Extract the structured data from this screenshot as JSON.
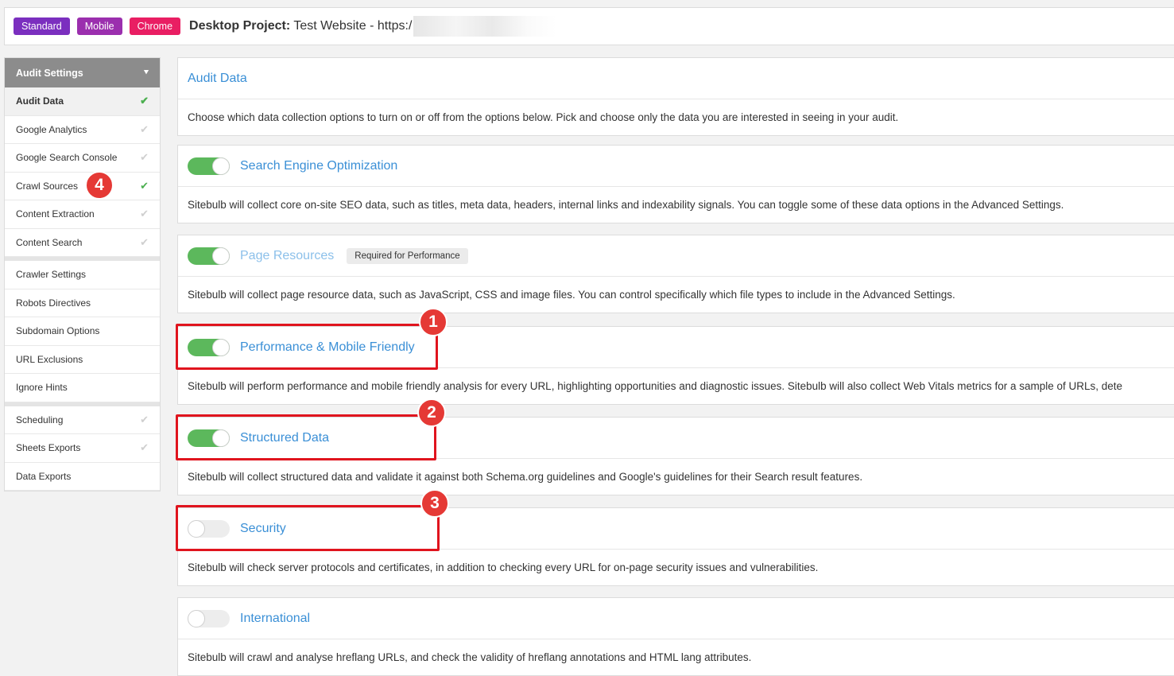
{
  "header": {
    "pills": [
      {
        "label": "Standard",
        "color": "#7b2fbf"
      },
      {
        "label": "Mobile",
        "color": "#9b2fae"
      },
      {
        "label": "Chrome",
        "color": "#e91e63"
      }
    ],
    "project_prefix": "Desktop Project:",
    "project_name": "Test Website - https:/"
  },
  "sidebar": {
    "title": "Audit Settings",
    "groups": [
      [
        {
          "label": "Audit Data",
          "check": "green",
          "active": true
        },
        {
          "label": "Google Analytics",
          "check": "grey"
        },
        {
          "label": "Google Search Console",
          "check": "grey"
        },
        {
          "label": "Crawl Sources",
          "check": "green",
          "badge": "4"
        },
        {
          "label": "Content Extraction",
          "check": "grey"
        },
        {
          "label": "Content Search",
          "check": "grey"
        }
      ],
      [
        {
          "label": "Crawler Settings",
          "check": ""
        },
        {
          "label": "Robots Directives",
          "check": ""
        },
        {
          "label": "Subdomain Options",
          "check": ""
        },
        {
          "label": "URL Exclusions",
          "check": ""
        },
        {
          "label": "Ignore Hints",
          "check": ""
        }
      ],
      [
        {
          "label": "Scheduling",
          "check": "grey"
        },
        {
          "label": "Sheets Exports",
          "check": "grey"
        },
        {
          "label": "Data Exports",
          "check": ""
        }
      ]
    ]
  },
  "intro": {
    "title": "Audit Data",
    "desc": "Choose which data collection options to turn on or off from the options below. Pick and choose only the data you are interested in seeing in your audit."
  },
  "options": [
    {
      "title": "Search Engine Optimization",
      "on": true,
      "faded": false,
      "desc": "Sitebulb will collect core on-site SEO data, such as titles, meta data, headers, internal links and indexability signals. You can toggle some of these data options in the Advanced Settings."
    },
    {
      "title": "Page Resources",
      "on": true,
      "faded": true,
      "tag": "Required for Performance",
      "desc": "Sitebulb will collect page resource data, such as JavaScript, CSS and image files. You can control specifically which file types to include in the Advanced Settings."
    },
    {
      "title": "Performance & Mobile Friendly",
      "on": true,
      "faded": false,
      "badge": "1",
      "desc": "Sitebulb will perform performance and mobile friendly analysis for every URL, highlighting opportunities and diagnostic issues. Sitebulb will also collect Web Vitals metrics for a sample of URLs, dete"
    },
    {
      "title": "Structured Data",
      "on": true,
      "faded": false,
      "badge": "2",
      "desc": "Sitebulb will collect structured data and validate it against both Schema.org guidelines and Google's guidelines for their Search result features."
    },
    {
      "title": "Security",
      "on": false,
      "faded": false,
      "badge": "3",
      "desc": "Sitebulb will check server protocols and certificates, in addition to checking every URL for on-page security issues and vulnerabilities."
    },
    {
      "title": "International",
      "on": false,
      "faded": false,
      "desc": "Sitebulb will crawl and analyse hreflang URLs, and check the validity of hreflang annotations and HTML lang attributes."
    }
  ]
}
